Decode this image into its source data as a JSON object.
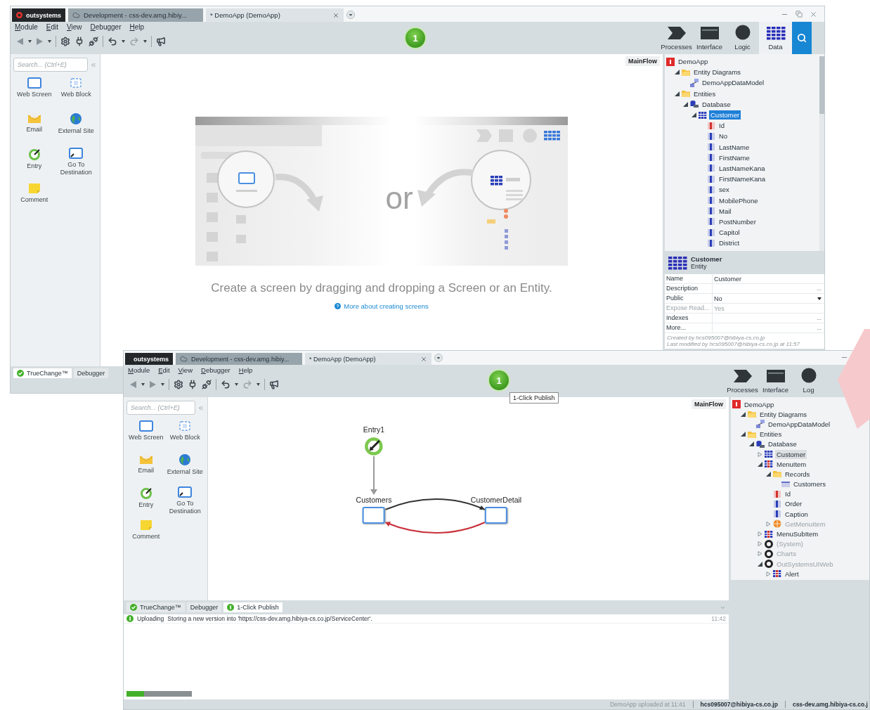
{
  "windows": [
    {
      "title_tabs": [
        {
          "label": "outsystems",
          "kind": "logo",
          "selected": false
        },
        {
          "label": "Development - css-dev.amg.hibiy...",
          "kind": "environment",
          "selected": false
        },
        {
          "label": "* DemoApp (DemoApp)",
          "kind": "module",
          "selected": true
        }
      ],
      "menu": [
        "Module",
        "Edit",
        "View",
        "Debugger",
        "Help"
      ],
      "publish_badge": "1",
      "app_tabs": [
        {
          "label": "Processes",
          "kind": "processes",
          "selected": false
        },
        {
          "label": "Interface",
          "kind": "interface",
          "selected": false
        },
        {
          "label": "Logic",
          "kind": "logic",
          "selected": false
        },
        {
          "label": "Data",
          "kind": "data",
          "selected": true
        }
      ],
      "palette": {
        "search_placeholder": "Search... (Ctrl+E)",
        "items": [
          {
            "label": "Web Screen",
            "kind": "screen"
          },
          {
            "label": "Web Block",
            "kind": "block"
          },
          {
            "label": "Email",
            "kind": "email"
          },
          {
            "label": "External Site",
            "kind": "external"
          },
          {
            "label": "Entry",
            "kind": "entry"
          },
          {
            "label": "Go To Destination",
            "kind": "goto"
          },
          {
            "label": "Comment",
            "kind": "comment"
          }
        ]
      },
      "flow_label": "MainFlow",
      "canvas": {
        "kind": "empty",
        "or_text": "or",
        "caption": "Create a screen by dragging and dropping a Screen or an Entity.",
        "link": "More about creating screens"
      },
      "tree_focused": true,
      "tree": [
        {
          "label": "DemoApp",
          "kind": "app",
          "selected": false,
          "children": [
            {
              "label": "Entity Diagrams",
              "kind": "folder",
              "selected": false,
              "expanded": true,
              "children": [
                {
                  "label": "DemoAppDataModel",
                  "kind": "diagram",
                  "selected": false
                }
              ]
            },
            {
              "label": "Entities",
              "kind": "folder",
              "selected": false,
              "expanded": true,
              "children": [
                {
                  "label": "Database",
                  "kind": "database",
                  "selected": false,
                  "expanded": true,
                  "children": [
                    {
                      "label": "Customer",
                      "kind": "entity",
                      "selected": true,
                      "expanded": true,
                      "children": [
                        {
                          "label": "Id",
                          "kind": "key",
                          "selected": false
                        },
                        {
                          "label": "No",
                          "kind": "attribute",
                          "selected": false
                        },
                        {
                          "label": "LastName",
                          "kind": "attribute",
                          "selected": false
                        },
                        {
                          "label": "FirstName",
                          "kind": "attribute",
                          "selected": false
                        },
                        {
                          "label": "LastNameKana",
                          "kind": "attribute",
                          "selected": false
                        },
                        {
                          "label": "FirstNameKana",
                          "kind": "attribute",
                          "selected": false
                        },
                        {
                          "label": "sex",
                          "kind": "attribute",
                          "selected": false
                        },
                        {
                          "label": "MobilePhone",
                          "kind": "attribute",
                          "selected": false
                        },
                        {
                          "label": "Mail",
                          "kind": "attribute",
                          "selected": false
                        },
                        {
                          "label": "PostNumber",
                          "kind": "attribute",
                          "selected": false
                        },
                        {
                          "label": "Capitol",
                          "kind": "attribute",
                          "selected": false
                        },
                        {
                          "label": "District",
                          "kind": "attribute",
                          "selected": false
                        }
                      ]
                    }
                  ]
                }
              ]
            }
          ]
        }
      ],
      "properties": {
        "title": "Customer",
        "subtitle": "Entity",
        "rows": [
          {
            "name": "Name",
            "value": "Customer",
            "kind": "text",
            "disabled": false
          },
          {
            "name": "Description",
            "button": "...",
            "kind": "editor",
            "disabled": false
          },
          {
            "name": "Public",
            "value": "No",
            "kind": "dropdown",
            "disabled": false
          },
          {
            "name": "Expose Read...",
            "value": "Yes",
            "kind": "text",
            "disabled": true
          },
          {
            "name": "Indexes",
            "button": "...",
            "kind": "editor",
            "disabled": false
          },
          {
            "name": "More...",
            "button": "...",
            "kind": "editor",
            "disabled": false
          }
        ],
        "created": "Created by hcs095007@hibiya-cs.co.jp",
        "modified": "Last modified by hcs095007@hibiya-cs.co.jp at 11:57"
      },
      "bottom_tabs": [
        {
          "label": "TrueChange™",
          "kind": "truechange",
          "selected": true
        },
        {
          "label": "Debugger",
          "kind": "plain",
          "selected": false
        }
      ]
    },
    {
      "title_tabs": [
        {
          "label": "outsystems",
          "kind": "logo",
          "selected": false
        },
        {
          "label": "Development - css-dev.amg.hibiy...",
          "kind": "environment",
          "selected": false
        },
        {
          "label": "* DemoApp (DemoApp)",
          "kind": "module",
          "selected": true
        }
      ],
      "menu": [
        "Module",
        "Edit",
        "View",
        "Debugger",
        "Help"
      ],
      "publish_badge": "1",
      "tooltip": "1-Click Publish",
      "app_tabs": [
        {
          "label": "Processes",
          "kind": "processes",
          "selected": false
        },
        {
          "label": "Interface",
          "kind": "interface",
          "selected": false
        },
        {
          "label": "Log",
          "kind": "logic",
          "selected": false
        }
      ],
      "palette": {
        "search_placeholder": "Search... (Ctrl+E)",
        "items": [
          {
            "label": "Web Screen",
            "kind": "screen"
          },
          {
            "label": "Web Block",
            "kind": "block"
          },
          {
            "label": "Email",
            "kind": "email"
          },
          {
            "label": "External Site",
            "kind": "external"
          },
          {
            "label": "Entry",
            "kind": "entry"
          },
          {
            "label": "Go To Destination",
            "kind": "goto"
          },
          {
            "label": "Comment",
            "kind": "comment"
          }
        ]
      },
      "flow_label": "MainFlow",
      "canvas": {
        "kind": "flow",
        "nodes": [
          {
            "label": "Entry1",
            "kind": "entry"
          },
          {
            "label": "Customers",
            "kind": "screen"
          },
          {
            "label": "CustomerDetail",
            "kind": "screen"
          }
        ],
        "edges": [
          {
            "color": "#9a9a9a"
          },
          {
            "color": "#333333"
          },
          {
            "color": "#c8303a"
          }
        ]
      },
      "tree_focused": false,
      "tree": [
        {
          "label": "DemoApp",
          "kind": "app",
          "selected": false,
          "disabled": false,
          "children": [
            {
              "label": "Entity Diagrams",
              "kind": "folder",
              "selected": false,
              "disabled": false,
              "expanded": true,
              "children": [
                {
                  "label": "DemoAppDataModel",
                  "kind": "diagram",
                  "selected": false,
                  "disabled": false
                }
              ]
            },
            {
              "label": "Entities",
              "kind": "folder",
              "selected": false,
              "disabled": false,
              "expanded": true,
              "children": [
                {
                  "label": "Database",
                  "kind": "database",
                  "selected": false,
                  "disabled": false,
                  "expanded": true,
                  "children": [
                    {
                      "label": "Customer",
                      "kind": "entity",
                      "selected": true,
                      "disabled": false,
                      "expanded": false
                    },
                    {
                      "label": "MenuItem",
                      "kind": "static",
                      "selected": false,
                      "disabled": false,
                      "expanded": true,
                      "children": [
                        {
                          "label": "Records",
                          "kind": "folder",
                          "selected": false,
                          "disabled": false,
                          "expanded": true,
                          "children": [
                            {
                              "label": "Customers",
                              "kind": "record",
                              "selected": false,
                              "disabled": false
                            }
                          ]
                        },
                        {
                          "label": "Id",
                          "kind": "key",
                          "selected": false,
                          "disabled": false
                        },
                        {
                          "label": "Order",
                          "kind": "attribute",
                          "selected": false,
                          "disabled": false
                        },
                        {
                          "label": "Caption",
                          "kind": "attribute",
                          "selected": false,
                          "disabled": false
                        },
                        {
                          "label": "GetMenuItem",
                          "kind": "action",
                          "selected": false,
                          "disabled": true,
                          "expanded": false
                        }
                      ]
                    },
                    {
                      "label": "MenuSubItem",
                      "kind": "static",
                      "selected": false,
                      "disabled": false,
                      "expanded": false
                    },
                    {
                      "label": "(System)",
                      "kind": "module",
                      "selected": false,
                      "disabled": true,
                      "expanded": false
                    },
                    {
                      "label": "Charts",
                      "kind": "module",
                      "selected": false,
                      "disabled": true,
                      "expanded": false
                    },
                    {
                      "label": "OutSystemsUIWeb",
                      "kind": "module",
                      "selected": false,
                      "disabled": true,
                      "expanded": true,
                      "children": [
                        {
                          "label": "Alert",
                          "kind": "static",
                          "selected": false,
                          "disabled": false,
                          "expanded": false
                        }
                      ]
                    }
                  ]
                }
              ]
            }
          ]
        }
      ],
      "output": {
        "tabs": [
          {
            "label": "TrueChange™",
            "kind": "truechange",
            "selected": false
          },
          {
            "label": "Debugger",
            "kind": "plain",
            "selected": false
          },
          {
            "label": "1-Click Publish",
            "kind": "publish",
            "selected": true
          }
        ],
        "log": [
          {
            "stage": "Uploading",
            "message": "Storing a new version into 'https://css-dev.amg.hibiya-cs.co.jp/ServiceCenter'.",
            "time": "11:42"
          }
        ],
        "progress": {
          "level": 0.27
        }
      },
      "status_bar": [
        "DemoApp uploaded at 11:41",
        "hcs095007@hibiya-cs.co.jp",
        "css-dev.amg.hibiya-cs.co.j"
      ]
    }
  ]
}
